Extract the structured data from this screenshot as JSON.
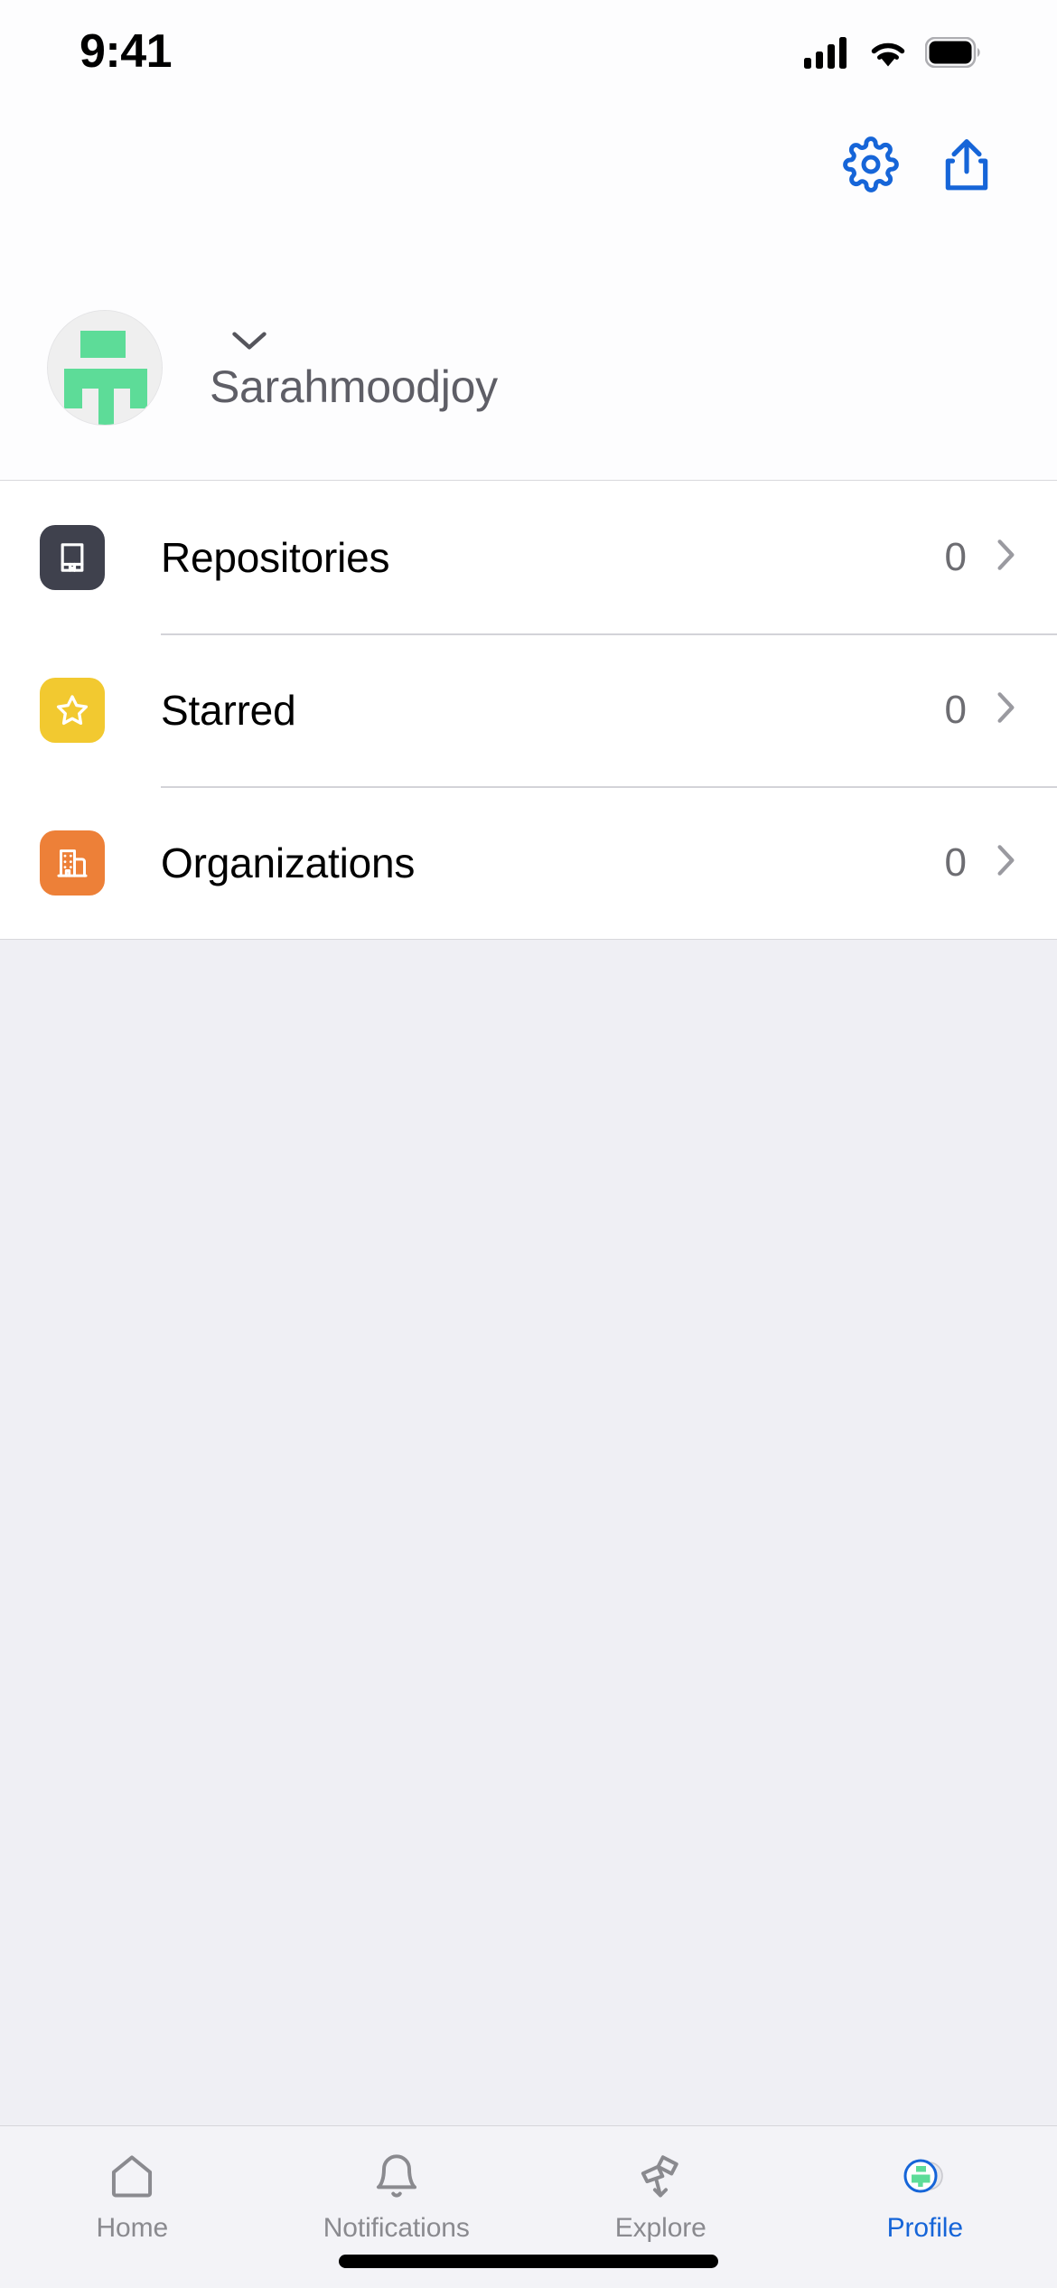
{
  "status_bar": {
    "time": "9:41",
    "cellular_icon": "cellular-signal-icon",
    "wifi_icon": "wifi-icon",
    "battery_icon": "battery-full-icon"
  },
  "header": {
    "settings_icon": "gear-icon",
    "share_icon": "share-icon",
    "cursor_indicator": "tap-indicator-dot"
  },
  "profile": {
    "avatar_icon": "gitea-logo-avatar",
    "avatar_bg": "#EFEFEF",
    "avatar_logo_color": "#5DDC98",
    "chevron_icon": "chevron-down-icon",
    "username": "Sarahmoodjoy"
  },
  "list": {
    "rows": [
      {
        "label": "Repositories",
        "value": "0",
        "icon": "repo-book-icon",
        "icon_bg": "#3F414D",
        "chevron": "chevron-right-icon"
      },
      {
        "label": "Starred",
        "value": "0",
        "icon": "star-icon",
        "icon_bg": "#F2C930",
        "chevron": "chevron-right-icon"
      },
      {
        "label": "Organizations",
        "value": "0",
        "icon": "organization-building-icon",
        "icon_bg": "#ED8038",
        "chevron": "chevron-right-icon"
      }
    ]
  },
  "tab_bar": {
    "active_color": "#1665D8",
    "inactive_color": "#8A8A8F",
    "tabs": [
      {
        "label": "Home",
        "icon": "home-icon",
        "active": false
      },
      {
        "label": "Notifications",
        "icon": "bell-icon",
        "active": false
      },
      {
        "label": "Explore",
        "icon": "telescope-icon",
        "active": false
      },
      {
        "label": "Profile",
        "icon": "profile-avatar-icon",
        "active": true
      }
    ]
  },
  "home_indicator": "home-indicator-bar"
}
